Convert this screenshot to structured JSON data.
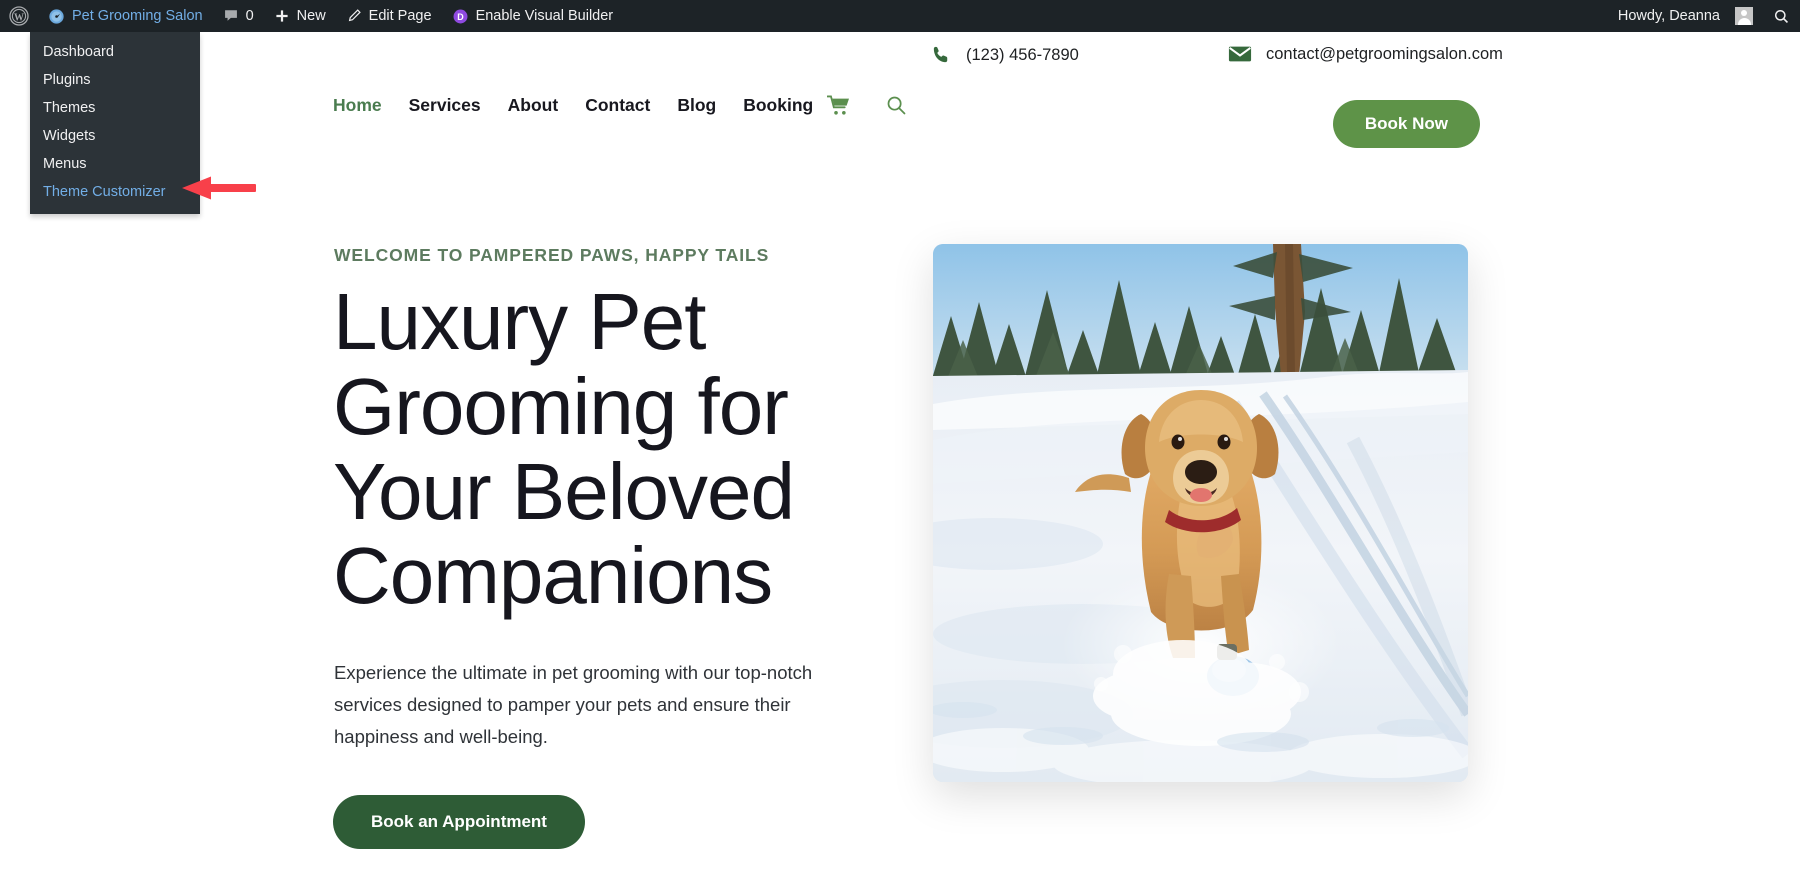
{
  "admin_bar": {
    "wp_logo_icon": "wordpress-logo-icon",
    "site_icon": "dashboard-icon",
    "site_name": "Pet Grooming Salon",
    "comments_icon": "comment-bubble-icon",
    "comments_count": "0",
    "new_icon": "plus-icon",
    "new_label": "New",
    "edit_icon": "pencil-icon",
    "edit_label": "Edit Page",
    "divi_badge_letter": "D",
    "divi_badge_color": "#8f4ae0",
    "visual_builder_label": "Enable Visual Builder",
    "howdy_label": "Howdy, Deanna",
    "avatar": "user-avatar",
    "search_icon": "search-icon",
    "background_color": "#1d2327",
    "link_color": "#72aee6"
  },
  "admin_dropdown": {
    "background_color": "#2c3338",
    "items": [
      {
        "label": "Dashboard",
        "highlighted": false
      },
      {
        "label": "Plugins",
        "highlighted": false
      },
      {
        "label": "Themes",
        "highlighted": false
      },
      {
        "label": "Widgets",
        "highlighted": false
      },
      {
        "label": "Menus",
        "highlighted": false
      },
      {
        "label": "Theme Customizer",
        "highlighted": true
      }
    ]
  },
  "annotation": {
    "name": "red-arrow-pointing-to-theme-customizer",
    "color": "#f8404a",
    "direction": "left"
  },
  "site_header": {
    "phone_icon": "phone-icon",
    "phone": "(123) 456-7890",
    "email_icon": "envelope-icon",
    "email": "contact@petgroomingsalon.com",
    "icon_color": "#36693c"
  },
  "nav": {
    "items": [
      {
        "label": "Home",
        "active": true
      },
      {
        "label": "Services",
        "active": false
      },
      {
        "label": "About",
        "active": false
      },
      {
        "label": "Contact",
        "active": false
      },
      {
        "label": "Blog",
        "active": false
      },
      {
        "label": "Booking",
        "active": false
      }
    ],
    "cart_icon": "shopping-cart-icon",
    "search_icon": "search-icon",
    "active_color": "#4a7c4f",
    "icon_color": "#5b8f4e"
  },
  "book_now_button": {
    "label": "Book Now",
    "background_color": "#5e9348"
  },
  "hero": {
    "eyebrow": "WELCOME TO PAMPERED PAWS, HAPPY TAILS",
    "title": "Luxury Pet Grooming for Your Beloved Companions",
    "paragraph": "Experience the ultimate in pet grooming with our top-notch services designed to pamper your pets and ensure their happiness and well-being.",
    "cta_label": "Book an Appointment",
    "cta_background_color": "#2e5c36",
    "eyebrow_color": "#5d7b5f",
    "image_alt": "golden-retriever-running-in-snow"
  }
}
